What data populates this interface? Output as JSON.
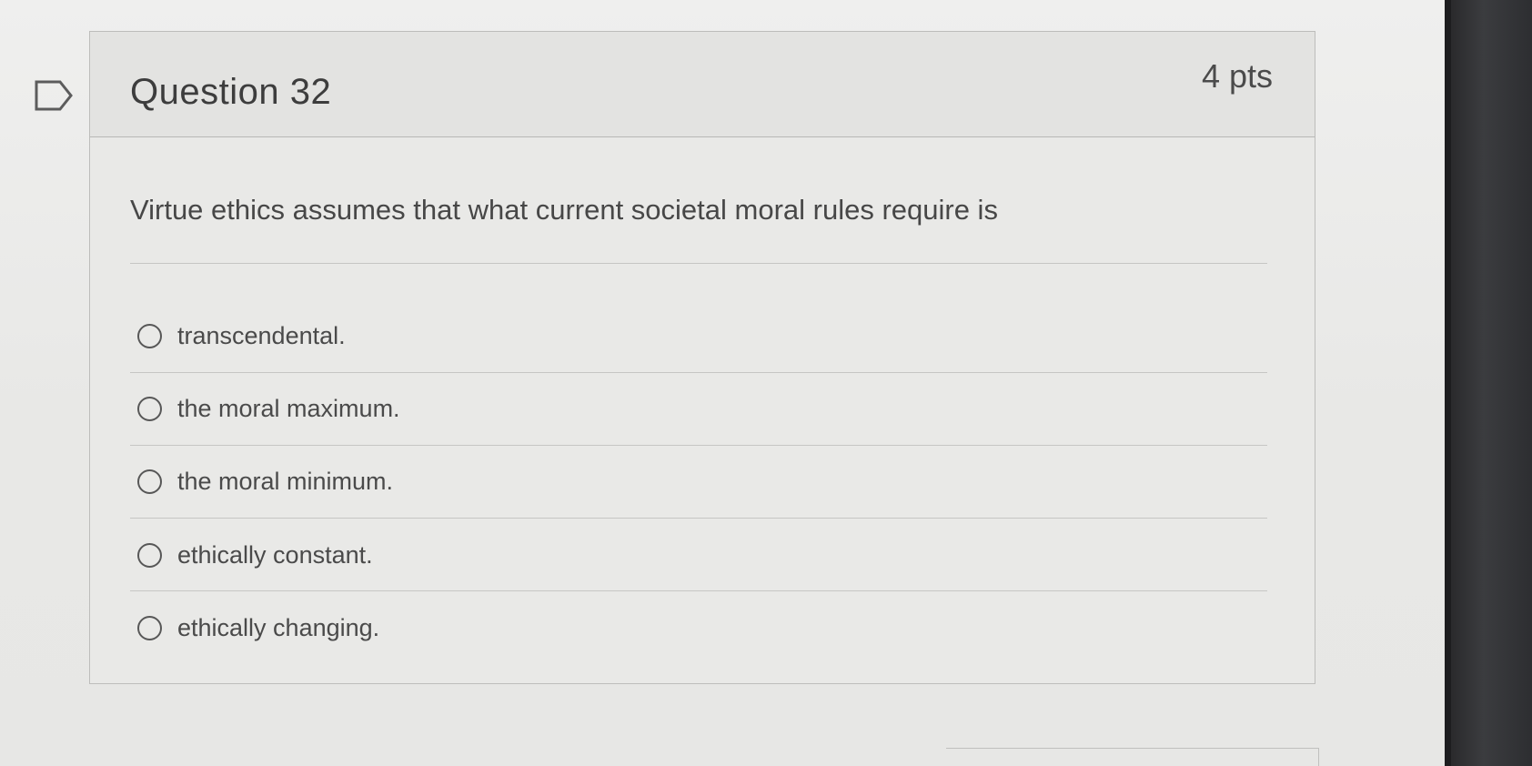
{
  "question": {
    "title": "Question 32",
    "points": "4 pts",
    "flag_icon": "flag-outline-icon",
    "text": "Virtue ethics assumes that what current societal moral rules require is",
    "answers": [
      {
        "label": "transcendental.",
        "selected": false
      },
      {
        "label": "the moral maximum.",
        "selected": false
      },
      {
        "label": "the moral minimum.",
        "selected": false
      },
      {
        "label": "ethically constant.",
        "selected": false
      },
      {
        "label": "ethically changing.",
        "selected": false
      }
    ]
  },
  "colors": {
    "page_background": "#ebebea",
    "card_header": "#e3e3e1",
    "border": "#bdbdbb",
    "text": "#3f3f3f",
    "device_frame": "#2a2a2c"
  }
}
